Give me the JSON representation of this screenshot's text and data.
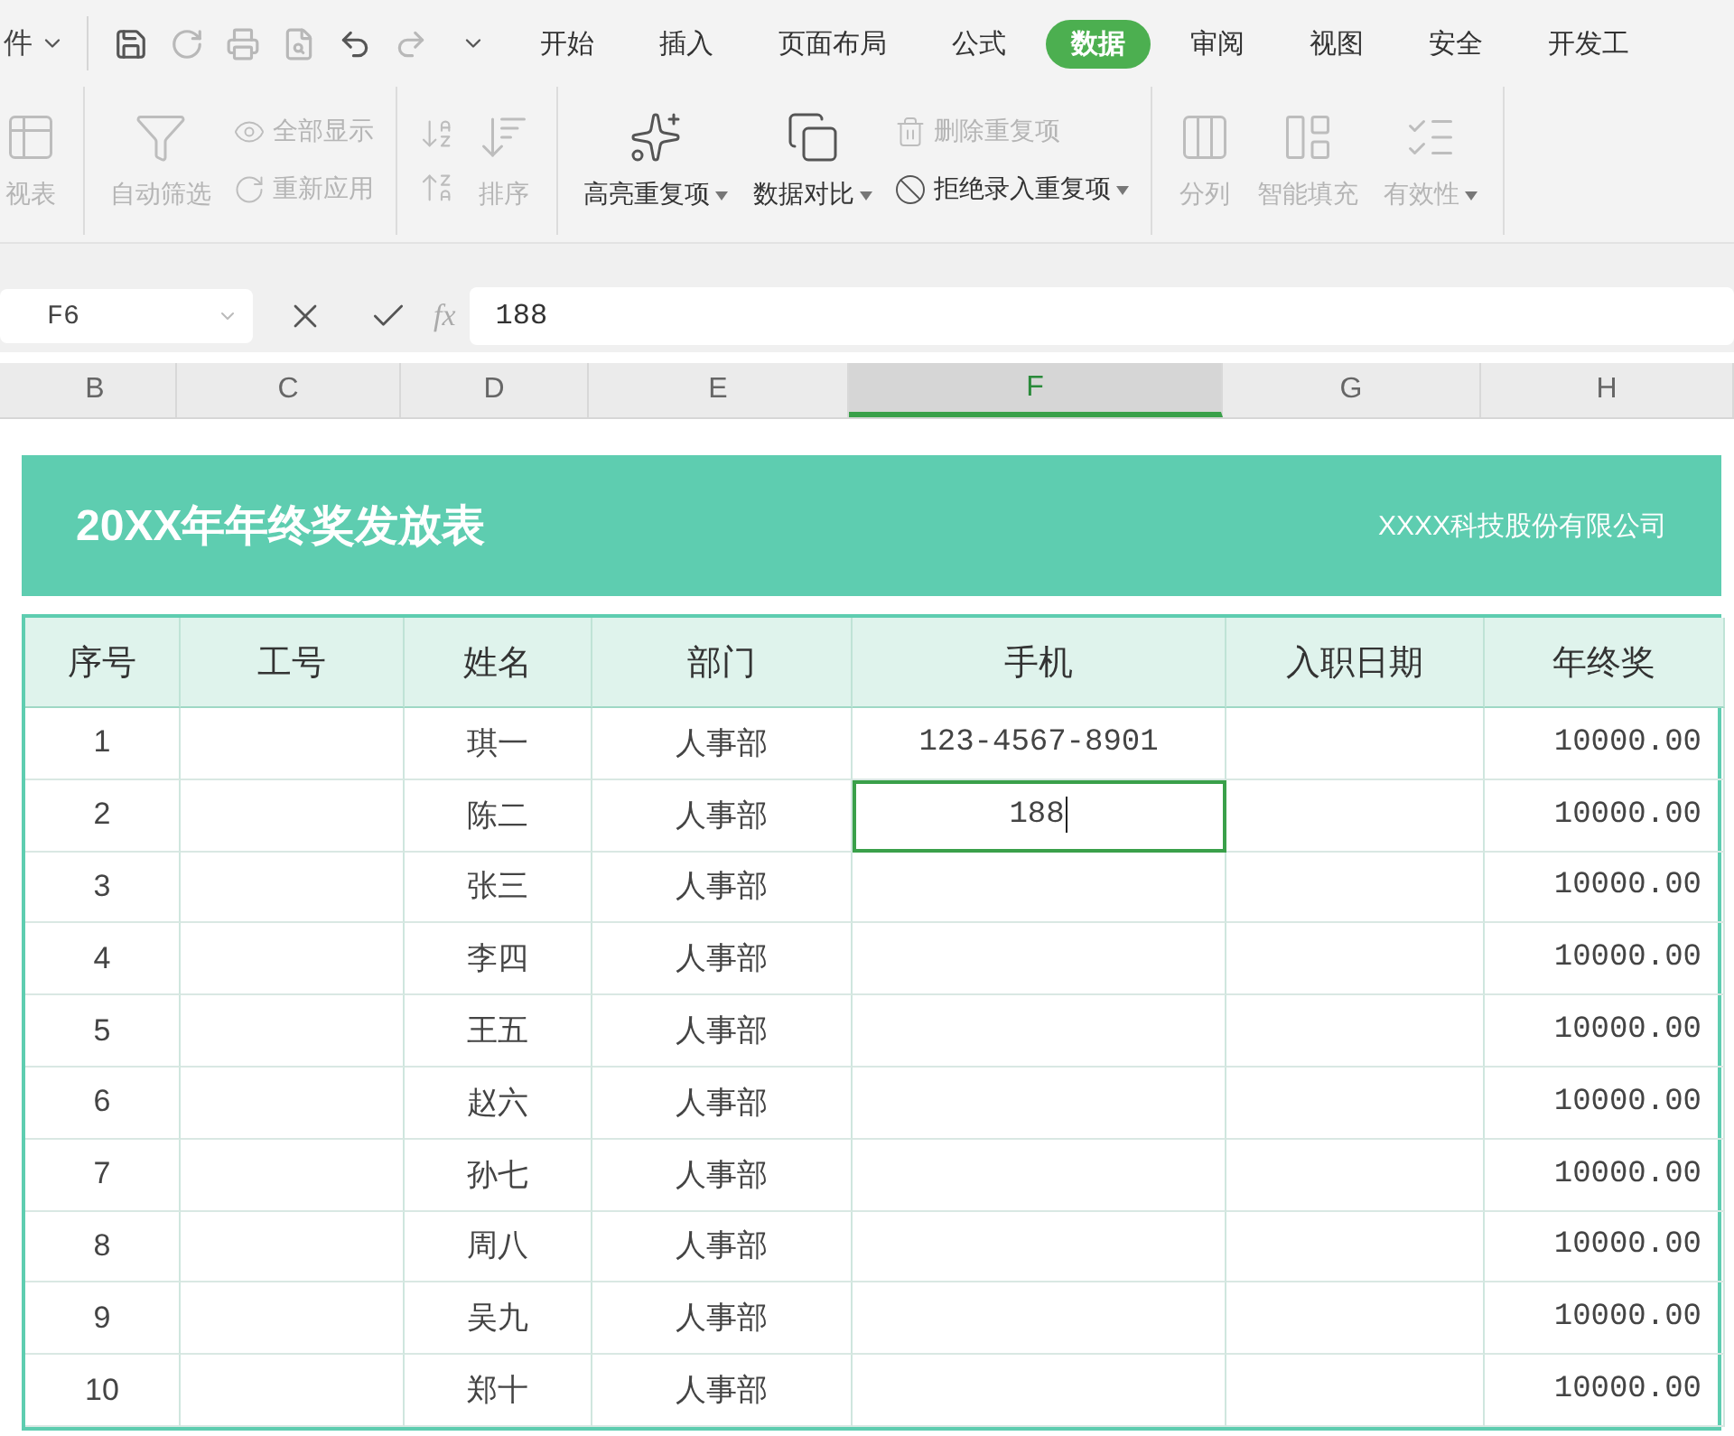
{
  "menu_bar": {
    "file_label": "件",
    "tabs": [
      {
        "label": "开始",
        "selected": false
      },
      {
        "label": "插入",
        "selected": false
      },
      {
        "label": "页面布局",
        "selected": false
      },
      {
        "label": "公式",
        "selected": false
      },
      {
        "label": "数据",
        "selected": true
      },
      {
        "label": "审阅",
        "selected": false
      },
      {
        "label": "视图",
        "selected": false
      },
      {
        "label": "安全",
        "selected": false
      },
      {
        "label": "开发工",
        "selected": false
      }
    ]
  },
  "ribbon": {
    "groups": [
      {
        "items": [
          {
            "kind": "large",
            "label": "视表",
            "disabled": true,
            "dropdown": false
          }
        ]
      },
      {
        "items": [
          {
            "kind": "large",
            "label": "自动筛选",
            "disabled": true,
            "dropdown": false
          },
          {
            "kind": "stack",
            "items": [
              {
                "label": "全部显示",
                "disabled": true,
                "dropdown": false
              },
              {
                "label": "重新应用",
                "disabled": true,
                "dropdown": false
              }
            ]
          }
        ]
      },
      {
        "items": [
          {
            "kind": "sort_icons",
            "disabled": true
          },
          {
            "kind": "large",
            "label": "排序",
            "disabled": true,
            "dropdown": false
          }
        ]
      },
      {
        "items": [
          {
            "kind": "large",
            "label": "高亮重复项",
            "disabled": false,
            "dropdown": true
          },
          {
            "kind": "large",
            "label": "数据对比",
            "disabled": false,
            "dropdown": true
          },
          {
            "kind": "stack",
            "items": [
              {
                "label": "删除重复项",
                "disabled": true,
                "dropdown": false
              },
              {
                "label": "拒绝录入重复项",
                "disabled": false,
                "dropdown": true
              }
            ]
          }
        ]
      },
      {
        "items": [
          {
            "kind": "large",
            "label": "分列",
            "disabled": true,
            "dropdown": false
          },
          {
            "kind": "large",
            "label": "智能填充",
            "disabled": true,
            "dropdown": false
          },
          {
            "kind": "large",
            "label": "有效性",
            "disabled": true,
            "dropdown": true
          }
        ]
      }
    ]
  },
  "formula_bar": {
    "cell_ref": "F6",
    "fx_label": "fx",
    "value": "188"
  },
  "column_headers": [
    {
      "label": "B",
      "selected": false
    },
    {
      "label": "C",
      "selected": false
    },
    {
      "label": "D",
      "selected": false
    },
    {
      "label": "E",
      "selected": false
    },
    {
      "label": "F",
      "selected": true
    },
    {
      "label": "G",
      "selected": false
    },
    {
      "label": "H",
      "selected": false
    }
  ],
  "sheet": {
    "title": "20XX年年终奖发放表",
    "company": "XXXX科技股份有限公司",
    "columns": [
      "序号",
      "工号",
      "姓名",
      "部门",
      "手机",
      "入职日期",
      "年终奖"
    ],
    "rows": [
      {
        "no": "1",
        "name": "琪一",
        "dept": "人事部",
        "phone": "123-4567-8901",
        "bonus": "10000.00",
        "editing": false
      },
      {
        "no": "2",
        "name": "陈二",
        "dept": "人事部",
        "phone": "188",
        "bonus": "10000.00",
        "editing": true
      },
      {
        "no": "3",
        "name": "张三",
        "dept": "人事部",
        "bonus": "10000.00",
        "editing": false
      },
      {
        "no": "4",
        "name": "李四",
        "dept": "人事部",
        "bonus": "10000.00",
        "editing": false
      },
      {
        "no": "5",
        "name": "王五",
        "dept": "人事部",
        "bonus": "10000.00",
        "editing": false
      },
      {
        "no": "6",
        "name": "赵六",
        "dept": "人事部",
        "bonus": "10000.00",
        "editing": false
      },
      {
        "no": "7",
        "name": "孙七",
        "dept": "人事部",
        "bonus": "10000.00",
        "editing": false
      },
      {
        "no": "8",
        "name": "周八",
        "dept": "人事部",
        "bonus": "10000.00",
        "editing": false
      },
      {
        "no": "9",
        "name": "吴九",
        "dept": "人事部",
        "bonus": "10000.00",
        "editing": false
      },
      {
        "no": "10",
        "name": "郑十",
        "dept": "人事部",
        "bonus": "10000.00",
        "editing": false
      }
    ]
  }
}
